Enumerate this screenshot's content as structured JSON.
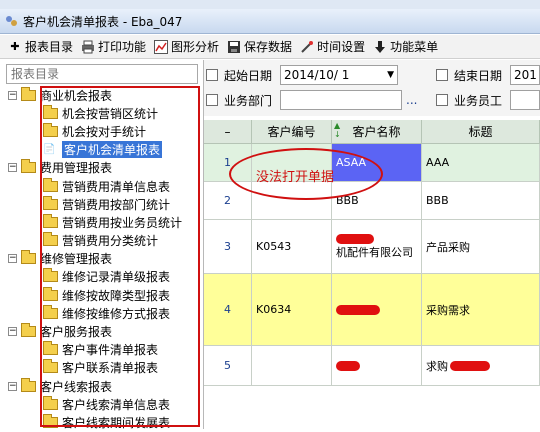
{
  "window": {
    "title": "客户机会清单报表 - Eba_047"
  },
  "toolbar": {
    "items": [
      {
        "label": "报表目录",
        "icon": "plus-icon"
      },
      {
        "label": "打印功能",
        "icon": "printer-icon"
      },
      {
        "label": "图形分析",
        "icon": "chart-icon"
      },
      {
        "label": "保存数据",
        "icon": "save-icon"
      },
      {
        "label": "时间设置",
        "icon": "wand-icon"
      },
      {
        "label": "功能菜单",
        "icon": "arrow-down-icon"
      }
    ]
  },
  "sidebar": {
    "search_placeholder": "报表目录",
    "groups": [
      {
        "label": "商业机会报表",
        "items": [
          "机会按营销区统计",
          "机会按对手统计",
          "客户机会清单报表"
        ]
      },
      {
        "label": "费用管理报表",
        "items": [
          "营销费用清单信息表",
          "营销费用按部门统计",
          "营销费用按业务员统计",
          "营销费用分类统计"
        ]
      },
      {
        "label": "维修管理报表",
        "items": [
          "维修记录清单级报表",
          "维修按故障类型报表",
          "维修按维修方式报表"
        ]
      },
      {
        "label": "客户服务报表",
        "items": [
          "客户事件清单报表",
          "客户联系清单报表"
        ]
      },
      {
        "label": "客户线索报表",
        "items": [
          "客户线索清单信息表",
          "客户线索期间发展表"
        ]
      }
    ]
  },
  "filters": {
    "start_label": "起始日期",
    "start_value": "2014/10/  1",
    "end_label": "结束日期",
    "end_value": "201",
    "dept_label": "业务部门",
    "staff_label": "业务员工",
    "ellipsis": "..."
  },
  "table": {
    "columns": [
      "–",
      "客户编号",
      "客户名称",
      "标题"
    ],
    "rows": [
      {
        "n": "1",
        "code": "",
        "name": "ASAA",
        "title": "AAA"
      },
      {
        "n": "2",
        "code": "",
        "name": "BBB",
        "title": "BBB"
      },
      {
        "n": "3",
        "code": "K0543",
        "name": "机配件有限公司",
        "title": "产品采购"
      },
      {
        "n": "4",
        "code": "K0634",
        "name": "",
        "title": "采购需求"
      },
      {
        "n": "5",
        "code": "",
        "name": "",
        "title": "求购"
      }
    ]
  },
  "annotation": {
    "text": "没法打开单据"
  },
  "colors": {
    "highlight_row": "#ffff99",
    "selected_cell": "#5b64f4",
    "red_mark": "#d01010"
  }
}
